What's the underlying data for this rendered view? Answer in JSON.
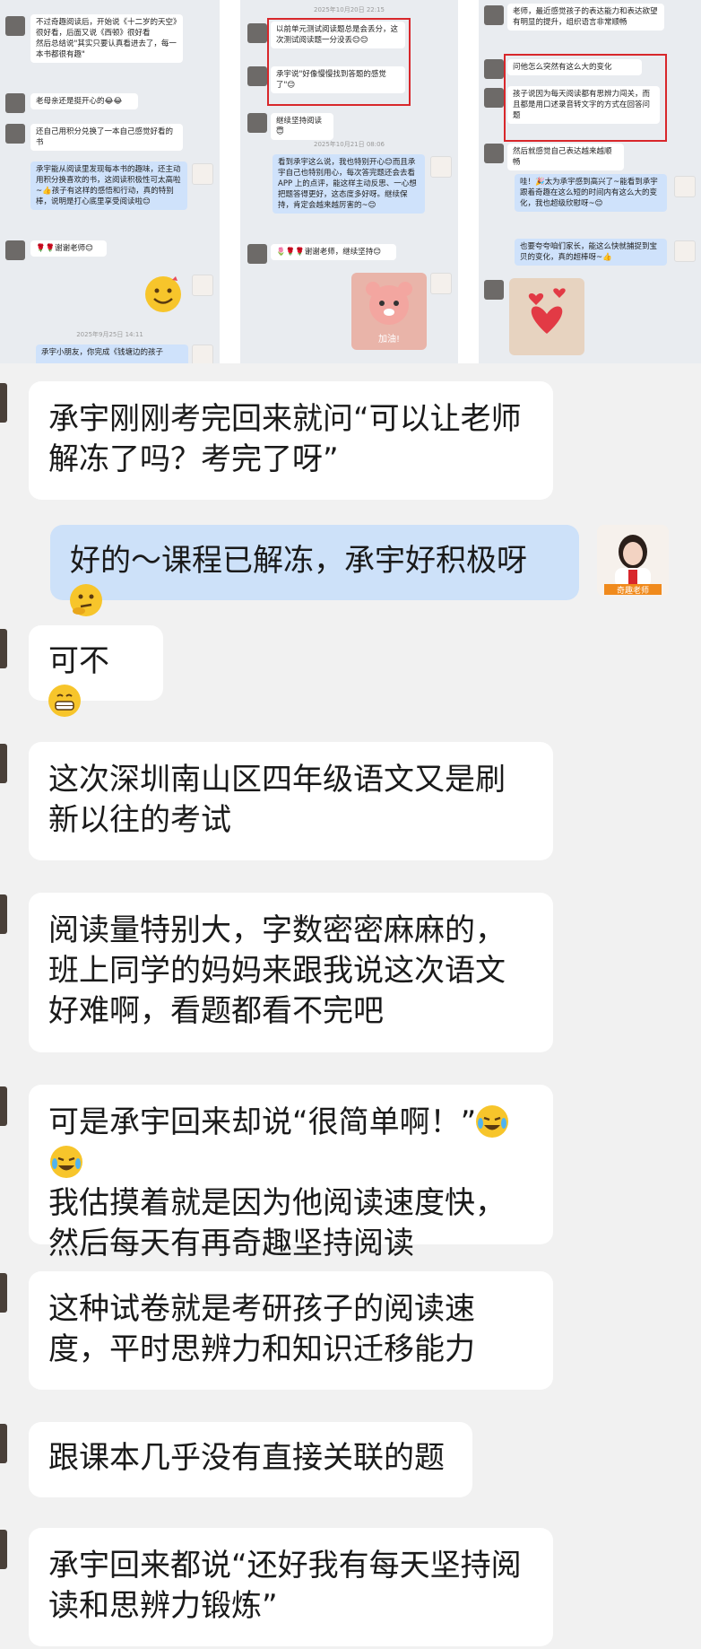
{
  "collage": {
    "panel1": {
      "msg1": "不过奇趣阅读后，开始说《十二岁的天空》很好看，后面又说《西顿》很好看\n然后总结说\"其实只要认真看进去了，每一本书都很有趣\"",
      "msg2": "老母亲还是挺开心的😂😂",
      "msg3": "还自己用积分兑换了一本自己感觉好看的书",
      "msg4": "承宇能从阅读里发现每本书的趣味，还主动用积分换喜欢的书，这阅读积极性可太高啦~👍孩子有这样的感悟和行动，真的特别棒，说明是打心底里享受阅读啦😊",
      "msg5": "🌹🌹谢谢老师😊",
      "timestamp": "2025年9月25日 14:11",
      "msg6": "承宇小朋友，你完成《钱塘边的孩子"
    },
    "panel2": {
      "timestamp1": "2025年10月20日 22:15",
      "msg1": "以前单元测试阅读题总是会丢分，这次测试阅读题一分没丢😊😊",
      "msg2": "承宇说\"好像慢慢找到答题的感觉了\"😊",
      "msg3": "继续坚持阅读😇",
      "timestamp2": "2025年10月21日 08:06",
      "msg4": "看到承宇这么说，我也特别开心😊而且承宇自己也特别用心，每次答完题还会去看 APP 上的点评，能这样主动反思、一心想把题答得更好，这态度多好呀。继续保持，肯定会越来越厉害的~😊",
      "msg5": "🌷🌹🌹谢谢老师，继续坚持😊",
      "sticker_caption": "加油!"
    },
    "panel3": {
      "msg1": "老师，最近感觉孩子的表达能力和表达欲望有明显的提升，组织语言非常顺畅",
      "msg2": "问他怎么突然有这么大的变化",
      "msg3": "孩子说因为每天阅读都有思辨力闯关，而且都是用口述录音转文字的方式在回答问题",
      "msg4": "然后就感觉自己表达越来越顺畅",
      "msg5": "哇！🎉太为承宇感到高兴了~能看到承宇跟着奇趣在这么短的时间内有这么大的变化，我也超级欣慰呀~😊",
      "msg6": "也要夸夸咱们家长，能这么快就捕捉到宝贝的变化，真的超棒呀~👍"
    }
  },
  "chat": {
    "messages": [
      {
        "text": "承宇刚刚考完回来就问“可以让老师解冻了吗？考完了呀”"
      },
      {
        "text": "好的～课程已解冻，承宇好积极呀",
        "emoji": "thinking-emoji"
      },
      {
        "text": "可不",
        "emoji": "grin-emoji"
      },
      {
        "text": "这次深圳南山区四年级语文又是刷新以往的考试"
      },
      {
        "text": "阅读量特别大，字数密密麻麻的，班上同学的妈妈来跟我说这次语文好难啊，看题都看不完吧"
      },
      {
        "text": "可是承宇回来却说“很简单啊！”",
        "emoji": "laugh-cry-emoji"
      },
      {
        "text": "这种试卷就是考研孩子的阅读速度，平时思辨力和知识迁移能力"
      },
      {
        "text": "跟课本几乎没有直接关联的题"
      },
      {
        "text": "承宇回来都说“还好我有每天坚持阅读和思辨力锻炼”"
      }
    ],
    "msg6_line2": "我估摸着就是因为他阅读速度快，然后每天有再奇趣坚持阅读",
    "teacher_avatar_label": "奇趣老师"
  },
  "colors": {
    "accent_red": "#d8272b",
    "my_bubble": "#cde1f9",
    "bubble": "#ffffff",
    "background": "#f1f1f1"
  }
}
